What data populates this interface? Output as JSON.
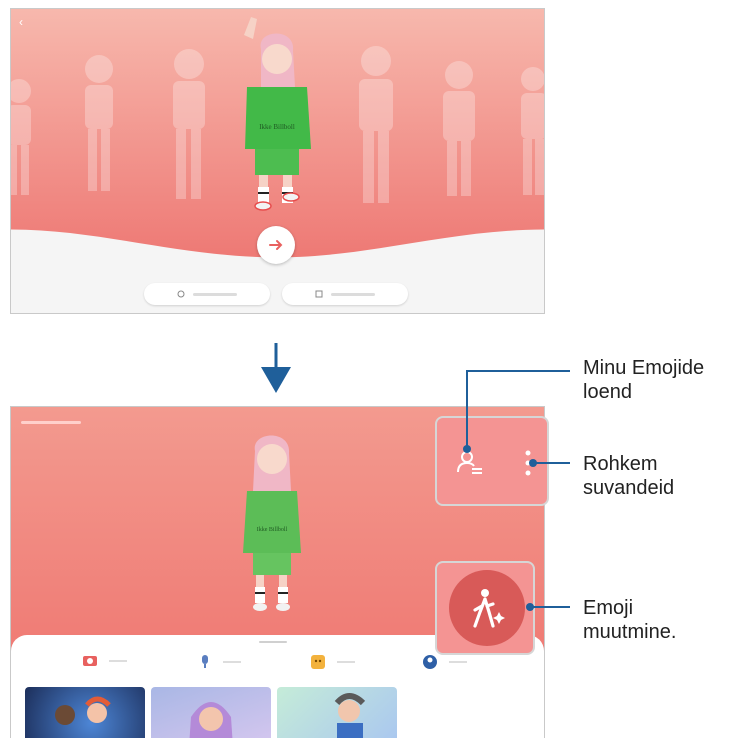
{
  "top_screen": {
    "back_label": "‹",
    "caption": "",
    "create_with_camera_label": "",
    "create_from_image_label": ""
  },
  "bottom_screen": {
    "header": "",
    "tabs": [
      {
        "icon": "camera-icon",
        "label": ""
      },
      {
        "icon": "microphone-icon",
        "label": ""
      },
      {
        "icon": "sticker-icon",
        "label": ""
      },
      {
        "icon": "profile-icon",
        "label": ""
      }
    ]
  },
  "callouts": {
    "emoji_list": "Minu Emojide loend",
    "more_options": "Rohkem suvandeid",
    "edit_emoji": "Emoji muutmine."
  },
  "colors": {
    "accent": "#e8615f",
    "panel_gradient_top": "#f6b0a8",
    "panel_gradient_bottom": "#ee6f6b",
    "callout_line": "#1f5f9a"
  }
}
